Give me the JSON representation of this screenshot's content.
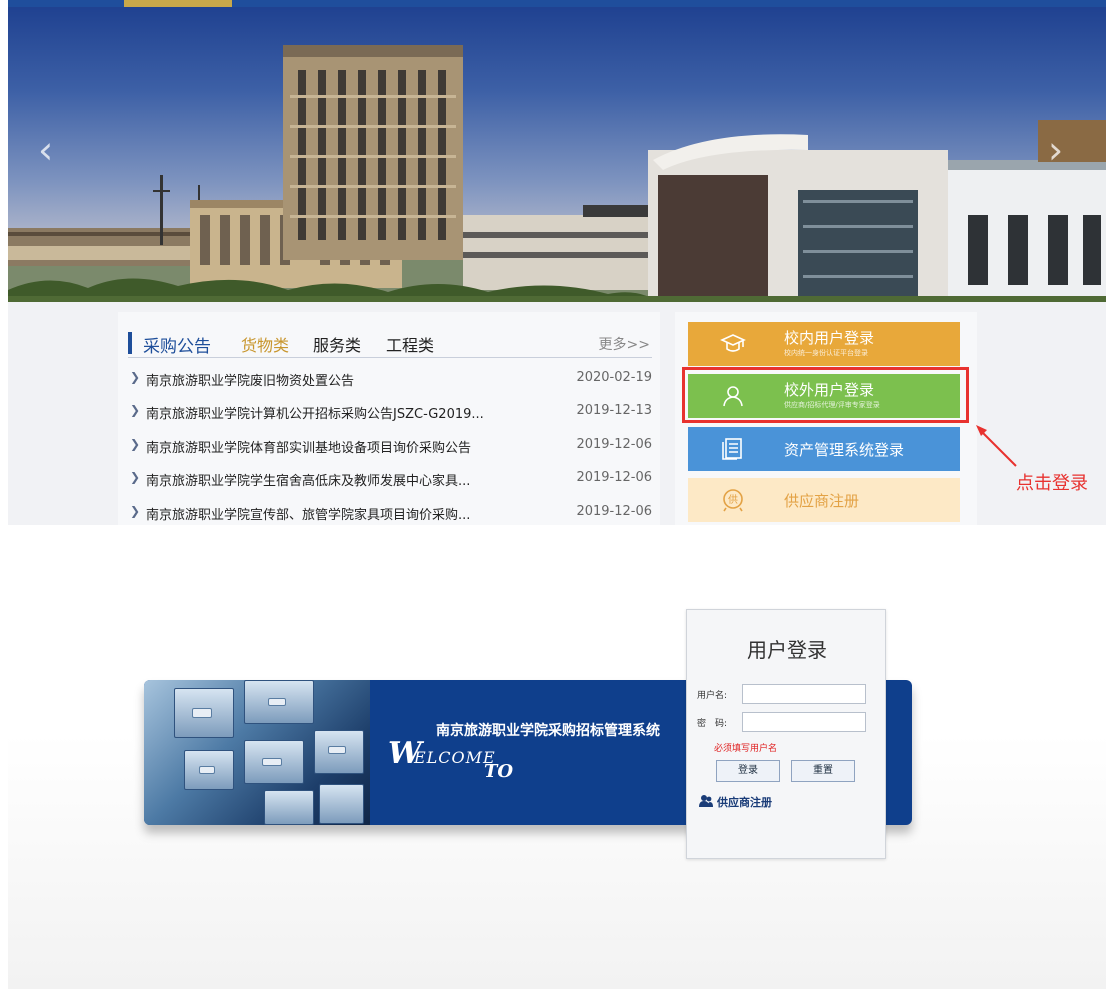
{
  "portal": {
    "news": {
      "tabs": {
        "main": "采购公告",
        "goods": "货物类",
        "service": "服务类",
        "project": "工程类",
        "more": "更多>>"
      },
      "items": [
        {
          "title": "南京旅游职业学院废旧物资处置公告",
          "date": "2020-02-19"
        },
        {
          "title": "南京旅游职业学院计算机公开招标采购公告JSZC-G2019...",
          "date": "2019-12-13"
        },
        {
          "title": "南京旅游职业学院体育部实训基地设备项目询价采购公告",
          "date": "2019-12-06"
        },
        {
          "title": "南京旅游职业学院学生宿舍高低床及教师发展中心家具...",
          "date": "2019-12-06"
        },
        {
          "title": "南京旅游职业学院宣传部、旅管学院家具项目询价采购...",
          "date": "2019-12-06"
        }
      ]
    },
    "login_buttons": {
      "inner": {
        "title": "校内用户登录",
        "subtitle": "校内统一身份认证平台登录",
        "icon": "graduation-cap-icon",
        "color": "#e8a83a"
      },
      "outer": {
        "title": "校外用户登录",
        "subtitle": "供应商/招标代理/评审专家登录",
        "icon": "user-icon",
        "color": "#7cc04e"
      },
      "asset": {
        "title": "资产管理系统登录",
        "icon": "document-list-icon",
        "color": "#4a93d8"
      },
      "supplier": {
        "title": "供应商注册",
        "icon": "supplier-seal-icon",
        "icon_text": "供",
        "color": "#fde9c6"
      }
    },
    "callout": {
      "text": "点击登录",
      "color": "#e8322f"
    }
  },
  "loginpage": {
    "system_name": "南京旅游职业学院采购招标管理系统",
    "welcome_art": "Welcome to",
    "form": {
      "title": "用户登录",
      "username_label": "用户名:",
      "password_label": "密　码:",
      "username_value": "",
      "password_value": "",
      "error": "必须填写用户名",
      "login_button": "登录",
      "reset_button": "重置",
      "register_link": "供应商注册"
    }
  }
}
